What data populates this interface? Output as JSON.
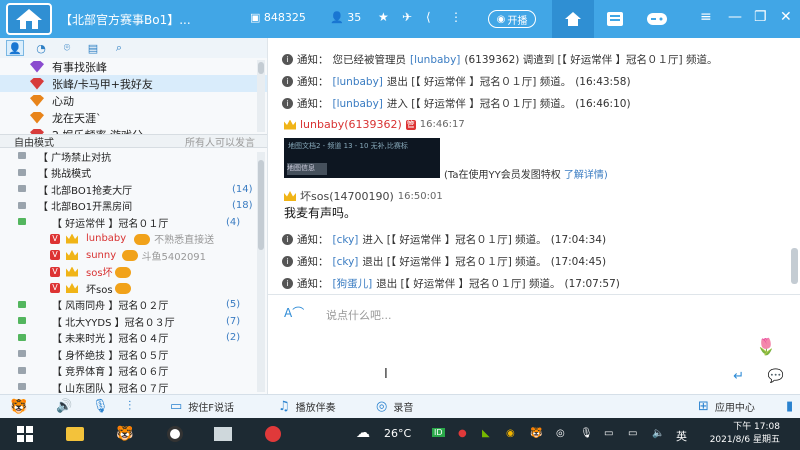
{
  "titlebar": {
    "title": "【北部官方赛事Bo1】...",
    "channel_id": "848325",
    "online_count": "35",
    "live_label": "开播",
    "tabs": [
      "home-icon",
      "grid-icon",
      "gamepad-icon"
    ]
  },
  "sidebar": {
    "favorites": [
      {
        "label": "有事找张峰",
        "selected": false,
        "color": "#8a4bcf"
      },
      {
        "label": "张峰/卡马甲+我好友",
        "selected": true,
        "color": "#d73b3b"
      },
      {
        "label": "心动",
        "selected": false,
        "color": "#e8841a"
      },
      {
        "label": "龙在天涯`",
        "selected": false,
        "color": "#e8841a"
      },
      {
        "label": "2 娱乐频率 游戏分",
        "selected": false,
        "color": "#d73b3b"
      }
    ],
    "mode_label": "自由模式",
    "mode_hint": "所有人可以发言",
    "tree": [
      {
        "indent": 1,
        "text": "【      广场禁止对抗",
        "type": "channel"
      },
      {
        "indent": 1,
        "text": "【      挑战模式",
        "type": "channel"
      },
      {
        "indent": 1,
        "text": "【      北部BO1抢麦大厅",
        "count": "(14)",
        "type": "channel"
      },
      {
        "indent": 1,
        "text": "【      北部BO1开黑房间",
        "count": "(18)",
        "type": "channel"
      },
      {
        "indent": 2,
        "text": "【    好运常伴   】冠名０１厅",
        "count": "(4)",
        "type": "room"
      },
      {
        "indent": 3,
        "text": "lunbaby",
        "note": "不熟悉直接送",
        "type": "user",
        "color": "#d83232"
      },
      {
        "indent": 3,
        "text": "sunny",
        "note": "斗鱼5402091",
        "type": "user",
        "color": "#d83232"
      },
      {
        "indent": 3,
        "text": "sos坏",
        "type": "user",
        "color": "#d83232"
      },
      {
        "indent": 3,
        "text": "坏sos",
        "type": "user",
        "color": "#222"
      },
      {
        "indent": 2,
        "text": "【    风雨同舟   】冠名０２厅",
        "count": "(5)",
        "type": "room"
      },
      {
        "indent": 2,
        "text": "【    北大YYDS   】冠名０３厅",
        "count": "(7)",
        "type": "room"
      },
      {
        "indent": 2,
        "text": "【    未来时光   】冠名０４厅",
        "count": "(2)",
        "type": "room"
      },
      {
        "indent": 2,
        "text": "【    身怀绝技   】冠名０５厅",
        "type": "room"
      },
      {
        "indent": 2,
        "text": "【    竞界体育   】冠名０６厅",
        "type": "room"
      },
      {
        "indent": 2,
        "text": "【    山东团队   】冠名０７厅",
        "type": "room"
      }
    ]
  },
  "chat": {
    "messages": [
      {
        "kind": "notice",
        "prefix": "通知：",
        "text": "您已经被管理员",
        "link": "[lunbaby]",
        "rest": "(6139362) 调遣到 [【    好运常伴  】冠名０１厅] 频道。",
        "time": ""
      },
      {
        "kind": "notice",
        "prefix": "通知：",
        "text": "",
        "link": "[lunbaby]",
        "rest": "退出 [【    好运常伴  】冠名０１厅] 频道。",
        "time": "(16:43:58)"
      },
      {
        "kind": "notice",
        "prefix": "通知：",
        "text": "",
        "link": "[lunbaby]",
        "rest": "进入 [【    好运常伴  】冠名０１厅] 频道。",
        "time": "(16:46:10)"
      }
    ],
    "sender1": {
      "name": "lunbaby(6139362)",
      "badge": "管",
      "time": "16:46:17"
    },
    "image_caption": "地图文档2 - 频道 13 - 10  无补,比赛标",
    "image_button": "地图信息",
    "vip_note": "(Ta在使用YY会员发图特权",
    "vip_link": "了解详情)",
    "sender2": {
      "name": "坏sos(14700190)",
      "time": "16:50:01"
    },
    "plain_text": "我麦有声吗。",
    "messages2": [
      {
        "prefix": "通知：",
        "link": "[cky]",
        "rest": "进入 [【    好运常伴  】冠名０１厅] 频道。",
        "time": "(17:04:34)"
      },
      {
        "prefix": "通知：",
        "link": "[cky]",
        "rest": "退出 [【    好运常伴  】冠名０１厅] 频道。",
        "time": "(17:04:45)"
      },
      {
        "prefix": "通知：",
        "link": "[狗蛋儿]",
        "rest": "退出 [【    好运常伴  】冠名０１厅] 频道。",
        "time": "(17:07:57)"
      }
    ]
  },
  "input": {
    "placeholder": "说点什么吧..."
  },
  "toolbar": {
    "push_to_talk": "按住F说话",
    "play_music": "播放伴奏",
    "record": "录音",
    "app_center": "应用中心"
  },
  "taskbar": {
    "weather": "26°C",
    "ime": "英",
    "time": "下午 17:08",
    "date": "2021/8/6 星期五"
  },
  "colors": {
    "brand": "#41a6e6",
    "link": "#3a7cc2",
    "highlight": "#d83232"
  }
}
